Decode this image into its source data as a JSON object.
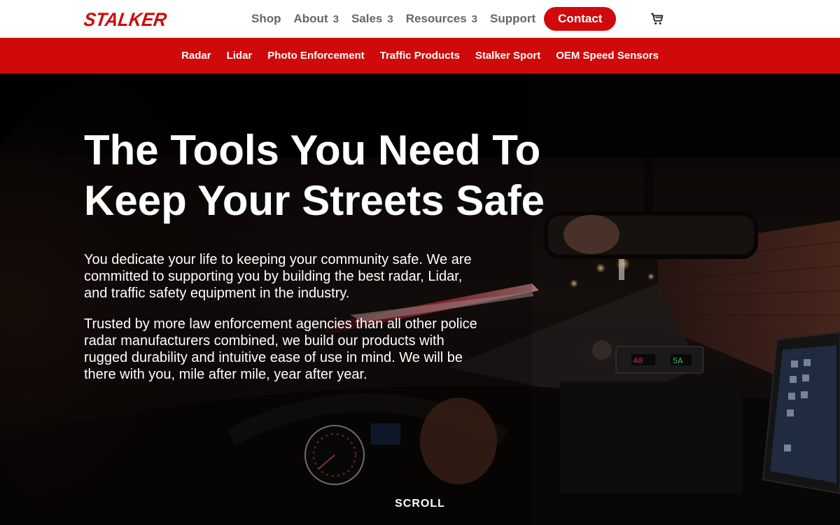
{
  "brand": {
    "logo_text": "STALKER",
    "accent": "#d00a0a"
  },
  "header": {
    "nav": [
      {
        "label": "Shop",
        "has_dropdown": false
      },
      {
        "label": "About",
        "has_dropdown": true
      },
      {
        "label": "Sales",
        "has_dropdown": true
      },
      {
        "label": "Resources",
        "has_dropdown": true
      },
      {
        "label": "Support",
        "has_dropdown": false
      }
    ],
    "dropdown_glyph": "3",
    "contact_label": "Contact",
    "cart_icon": "shopping-cart-icon"
  },
  "subnav": [
    "Radar",
    "Lidar",
    "Photo Enforcement",
    "Traffic Products",
    "Stalker Sport",
    "OEM Speed Sensors"
  ],
  "hero": {
    "title_line1": "The Tools You Need To",
    "title_line2": "Keep Your Streets Safe",
    "paragraph1": "You dedicate your life to keeping your community safe. We are committed to supporting you by building the best radar, Lidar, and traffic safety equipment in the industry.",
    "paragraph2": "Trusted by more law enforcement agencies than all other police radar manufacturers combined, we build our products with rugged durability and intuitive ease of use in mind. We will be there with you, mile after mile, year after year.",
    "scroll_label": "SCROLL",
    "radar_display": {
      "target": "40",
      "patrol": "5A"
    }
  }
}
